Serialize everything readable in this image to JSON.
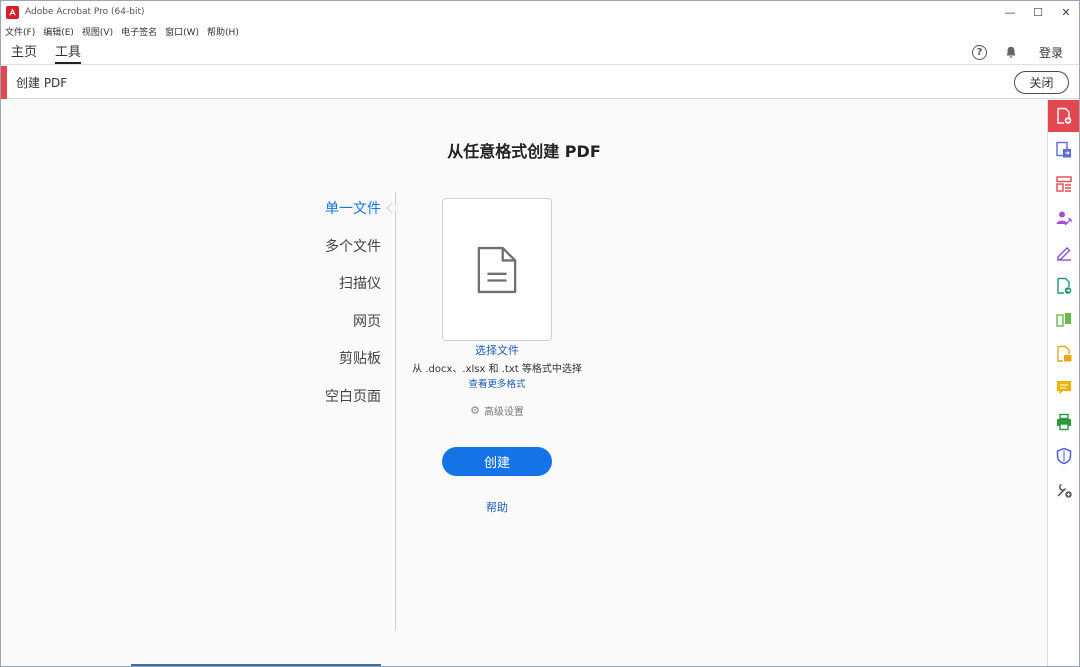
{
  "window": {
    "title": "Adobe Acrobat Pro (64-bit)",
    "controls": {
      "minimize": "—",
      "maximize": "☐",
      "close": "✕"
    }
  },
  "menubar": {
    "items": [
      "文件(F)",
      "编辑(E)",
      "视图(V)",
      "电子签名",
      "窗口(W)",
      "帮助(H)"
    ]
  },
  "tabs": {
    "home": "主页",
    "tools": "工具",
    "signin": "登录"
  },
  "tool_header": {
    "title": "创建 PDF",
    "close_label": "关闭"
  },
  "main": {
    "heading": "从任意格式创建 PDF",
    "options": [
      "单一文件",
      "多个文件",
      "扫描仪",
      "网页",
      "剪贴板",
      "空白页面"
    ],
    "active_option": "单一文件",
    "choose_file": "选择文件",
    "description": "从 .docx、.xlsx 和 .txt 等格式中选择",
    "more_formats": "查看更多格式",
    "advanced_settings": "高级设置",
    "create_button": "创建",
    "help_link": "帮助"
  },
  "rail_icons": [
    "create-pdf-icon",
    "export-pdf-icon",
    "organize-pages-icon",
    "request-esign-icon",
    "fill-sign-icon",
    "edit-pdf-icon",
    "compare-icon",
    "scan-ocr-icon",
    "comment-icon",
    "print-production-icon",
    "protect-icon",
    "more-tools-icon"
  ],
  "colors": {
    "accent_red": "#e34850",
    "primary_blue": "#1473e6",
    "link_blue": "#1a5fb4"
  }
}
